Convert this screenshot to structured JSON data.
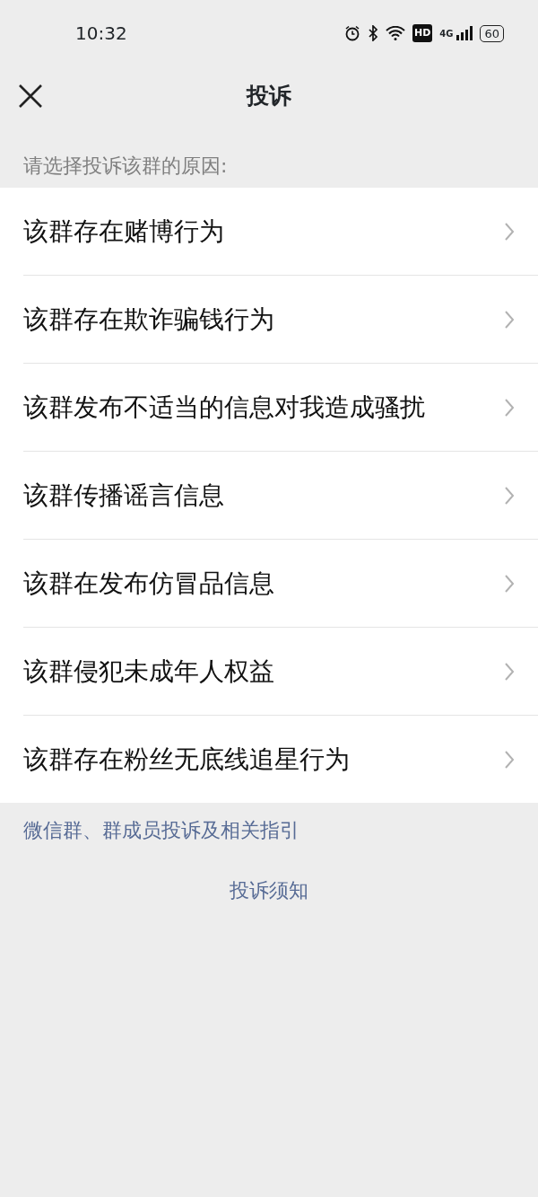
{
  "status_bar": {
    "time": "10:32",
    "network": "4G",
    "hd": "HD",
    "battery": "60"
  },
  "header": {
    "title": "投诉"
  },
  "prompt": "请选择投诉该群的原因:",
  "reasons": [
    {
      "label": "该群存在赌博行为"
    },
    {
      "label": "该群存在欺诈骗钱行为"
    },
    {
      "label": "该群发布不适当的信息对我造成骚扰"
    },
    {
      "label": "该群传播谣言信息"
    },
    {
      "label": "该群在发布仿冒品信息"
    },
    {
      "label": "该群侵犯未成年人权益"
    },
    {
      "label": "该群存在粉丝无底线追星行为"
    }
  ],
  "guide_link": "微信群、群成员投诉及相关指引",
  "notice_link": "投诉须知"
}
